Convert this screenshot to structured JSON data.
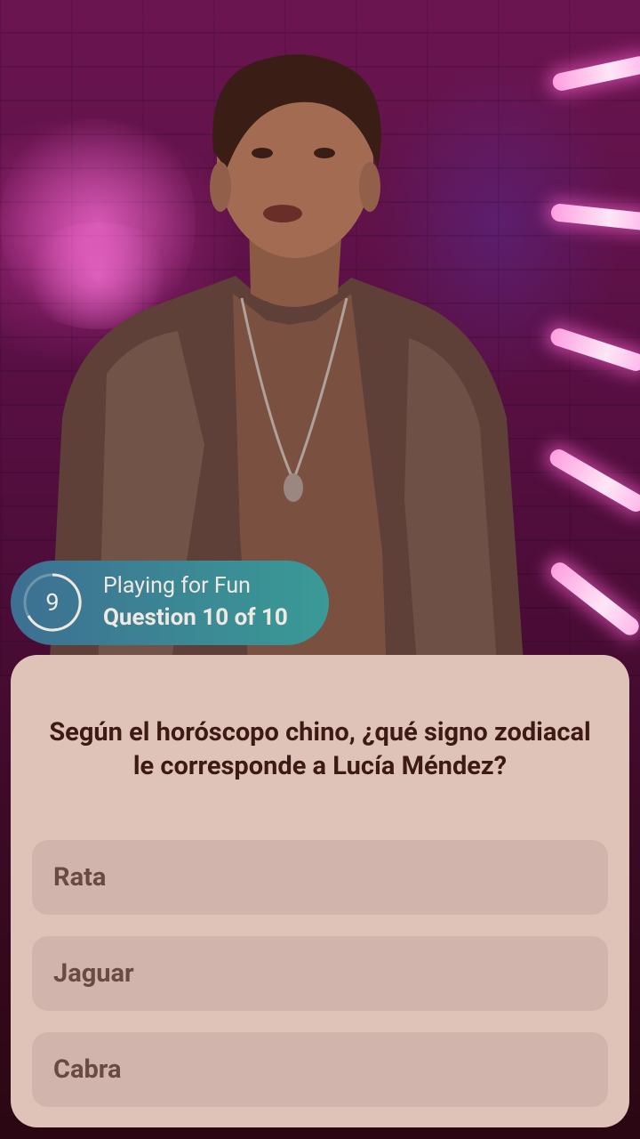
{
  "status": {
    "timer_value": "9",
    "mode": "Playing for Fun",
    "progress": "Question 10 of 10"
  },
  "question": {
    "text": "Según el horóscopo chino, ¿qué signo zodiacal le corresponde a Lucía Méndez?"
  },
  "answers": [
    {
      "label": "Rata"
    },
    {
      "label": "Jaguar"
    },
    {
      "label": "Cabra"
    }
  ],
  "colors": {
    "card": "#dfc3b8",
    "answer_bg": "#d1b5ac",
    "question_text": "#3d1a14",
    "answer_text": "#6a4a43",
    "pill_start": "#3d6f92",
    "pill_end": "#3a9a96"
  }
}
